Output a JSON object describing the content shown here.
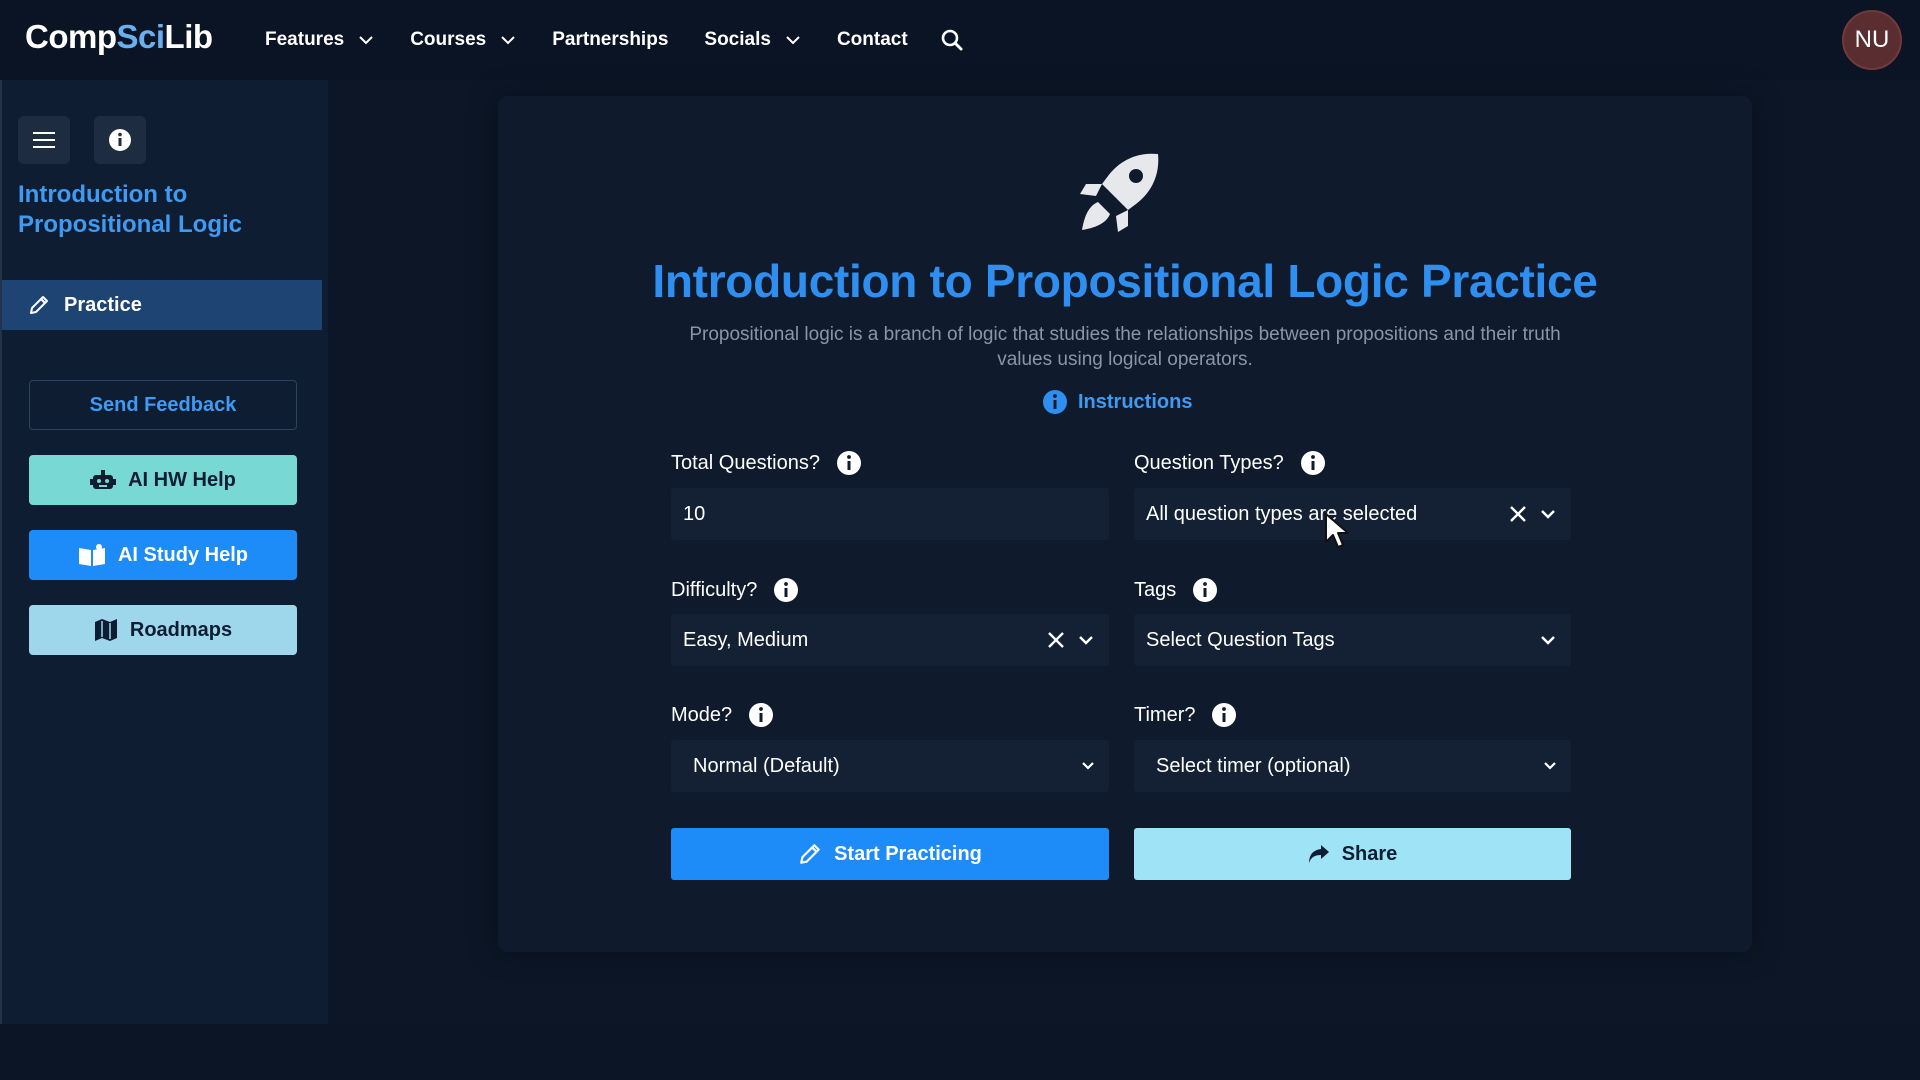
{
  "nav": {
    "logo_main": "Comp",
    "logo_accent": "Sci",
    "logo_tail": "Lib",
    "links": [
      {
        "label": "Features",
        "has_dropdown": true
      },
      {
        "label": "Courses",
        "has_dropdown": true
      },
      {
        "label": "Partnerships",
        "has_dropdown": false
      },
      {
        "label": "Socials",
        "has_dropdown": true
      },
      {
        "label": "Contact",
        "has_dropdown": false
      }
    ],
    "search_icon": "search-icon",
    "avatar_initials": "NU"
  },
  "sidebar": {
    "course_title": "Introduction to Propositional Logic",
    "active_item": "Practice",
    "buttons": {
      "feedback": "Send Feedback",
      "hw_help": "AI HW Help",
      "study_help": "AI Study Help",
      "roadmaps": "Roadmaps"
    }
  },
  "main": {
    "title": "Introduction to Propositional Logic Practice",
    "description": "Propositional logic is a branch of logic that studies the relationships between propositions and their truth values using logical operators.",
    "instructions_label": "Instructions",
    "fields": {
      "total_questions": {
        "label": "Total Questions?",
        "value": "10"
      },
      "question_types": {
        "label": "Question Types?",
        "value": "All question types are selected"
      },
      "difficulty": {
        "label": "Difficulty?",
        "value": "Easy, Medium"
      },
      "tags": {
        "label": "Tags",
        "value": "Select Question Tags"
      },
      "mode": {
        "label": "Mode?",
        "value": "Normal (Default)"
      },
      "timer": {
        "label": "Timer?",
        "value": "Select timer (optional)"
      }
    },
    "actions": {
      "start": "Start Practicing",
      "share": "Share"
    }
  },
  "colors": {
    "accent_blue": "#2f8ff0",
    "button_blue": "#1d8cf8",
    "teal": "#77d8d4",
    "light_blue": "#9ed6ec",
    "share_blue": "#9fe3f6",
    "background": "#0c1626"
  }
}
